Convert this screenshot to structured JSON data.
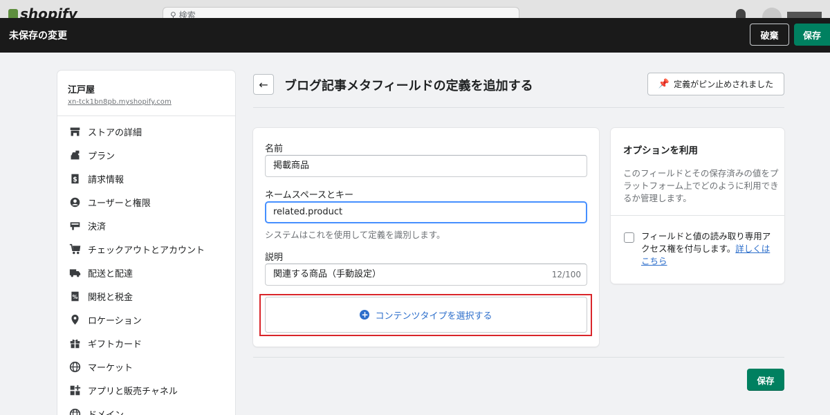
{
  "background_topbar": {
    "logo_text": "shopify",
    "search_placeholder": "検索"
  },
  "savebar": {
    "title": "未保存の変更",
    "discard_label": "破棄",
    "save_label": "保存"
  },
  "sidebar": {
    "store_name": "江戸屋",
    "store_url": "xn-tck1bn8pb.myshopify.com",
    "items": [
      {
        "label": "ストアの詳細",
        "icon": "store-icon"
      },
      {
        "label": "プラン",
        "icon": "plan-icon"
      },
      {
        "label": "請求情報",
        "icon": "billing-icon"
      },
      {
        "label": "ユーザーと権限",
        "icon": "user-icon"
      },
      {
        "label": "決済",
        "icon": "payment-icon"
      },
      {
        "label": "チェックアウトとアカウント",
        "icon": "cart-icon"
      },
      {
        "label": "配送と配達",
        "icon": "truck-icon"
      },
      {
        "label": "関税と税金",
        "icon": "tax-icon"
      },
      {
        "label": "ロケーション",
        "icon": "location-icon"
      },
      {
        "label": "ギフトカード",
        "icon": "gift-icon"
      },
      {
        "label": "マーケット",
        "icon": "globe-icon"
      },
      {
        "label": "アプリと販売チャネル",
        "icon": "apps-icon"
      },
      {
        "label": "ドメイン",
        "icon": "domain-icon"
      }
    ]
  },
  "header": {
    "back_arrow": "←",
    "title": "ブログ記事メタフィールドの定義を追加する",
    "pin_label": "定義がピン止めされました"
  },
  "form": {
    "name_label": "名前",
    "name_value": "掲載商品",
    "namespace_label": "ネームスペースとキー",
    "namespace_value": "related.product",
    "namespace_help": "システムはこれを使用して定義を識別します。",
    "description_label": "説明",
    "description_value": "関連する商品（手動設定）",
    "description_count": "12/100",
    "content_type_button": "コンテンツタイプを選択する"
  },
  "options": {
    "title": "オプションを利用",
    "description": "このフィールドとその保存済みの値をプラットフォーム上でどのように利用できるか管理します。",
    "checkbox_text": "フィールドと値の読み取り専用アクセス権を付与します。",
    "checkbox_link": "詳しくはこちら",
    "checkbox_checked": false
  },
  "footer": {
    "save_label": "保存"
  },
  "colors": {
    "primary_green": "#008060",
    "link_blue": "#2c6ecb",
    "highlight_red": "#d9252a",
    "focus_blue": "#458fff"
  }
}
